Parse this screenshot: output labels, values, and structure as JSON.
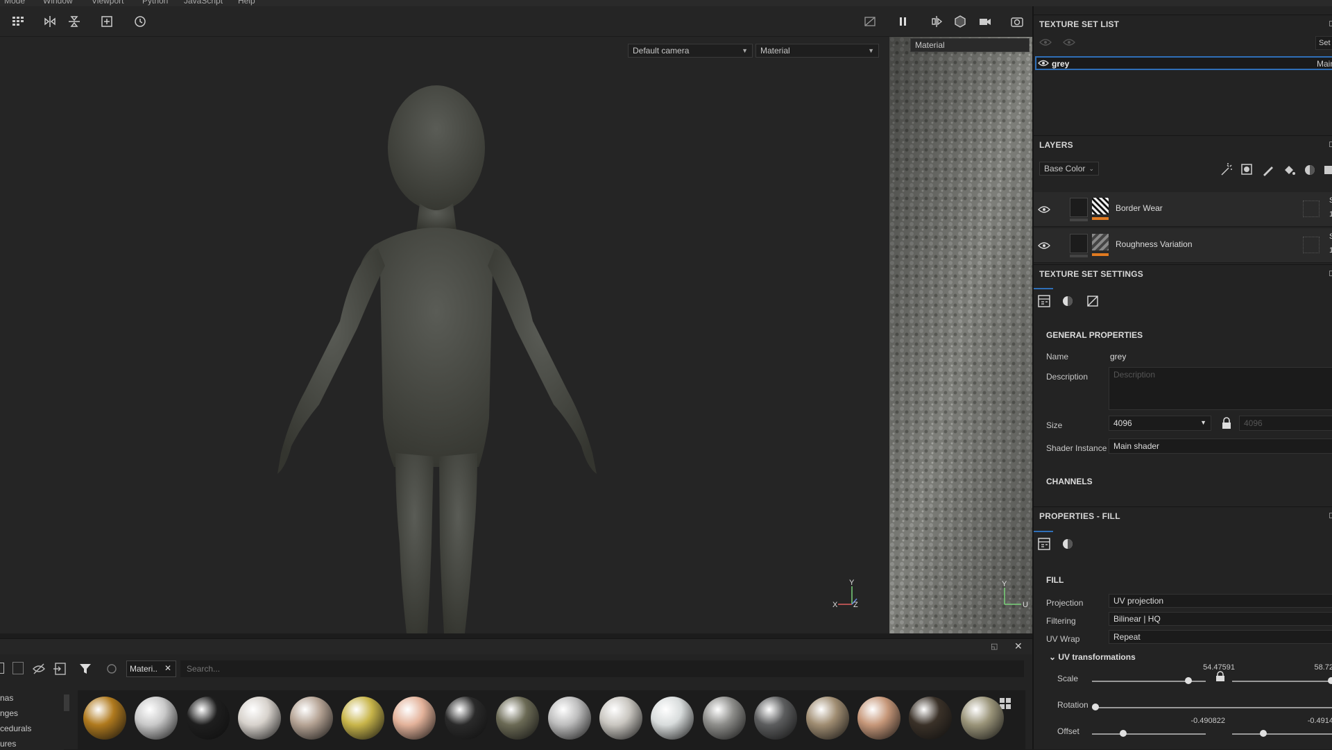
{
  "menu": [
    "Mode",
    "Window",
    "Viewport",
    "Python",
    "JavaScript",
    "Help"
  ],
  "viewport": {
    "camera_dropdown": "Default camera",
    "mode_dropdown": "Material",
    "uv_mode_dropdown": "Material",
    "axis_3d": {
      "y": "Y",
      "x": "X",
      "z": "Z"
    },
    "axis_uv": {
      "y": "Y",
      "u": "U"
    }
  },
  "texture_set_list": {
    "title": "TEXTURE SET LIST",
    "settings_btn": "Set",
    "item": {
      "name": "grey",
      "shader": "Main"
    }
  },
  "layers": {
    "title": "LAYERS",
    "channel_dropdown": "Base Color",
    "items": [
      {
        "name": "Border Wear",
        "blend": "S",
        "opacity": "1"
      },
      {
        "name": "Roughness Variation",
        "blend": "S",
        "opacity": "1"
      }
    ]
  },
  "texture_set_settings": {
    "title": "TEXTURE SET SETTINGS",
    "general_title": "GENERAL PROPERTIES",
    "name_label": "Name",
    "name_value": "grey",
    "description_label": "Description",
    "description_placeholder": "Description",
    "size_label": "Size",
    "size_value": "4096",
    "size_locked_value": "4096",
    "shader_label": "Shader Instance",
    "shader_value": "Main shader",
    "channels_title": "CHANNELS"
  },
  "properties_fill": {
    "title": "PROPERTIES - FILL",
    "fill_title": "FILL",
    "projection_label": "Projection",
    "projection_value": "UV projection",
    "filtering_label": "Filtering",
    "filtering_value": "Bilinear | HQ",
    "uvwrap_label": "UV Wrap",
    "uvwrap_value": "Repeat",
    "uv_transform_title": "UV transformations",
    "scale_label": "Scale",
    "scale_value": "54.47591",
    "scale_value_2": "58.72",
    "rotation_label": "Rotation",
    "offset_label": "Offset",
    "offset_value": "-0.490822",
    "offset_value_2": "-0.4914"
  },
  "shelf": {
    "categories": [
      "nas",
      "nges",
      "cedurals",
      "ures"
    ],
    "tab_label": "Materi..",
    "search_placeholder": "Search...",
    "sphere_colors": [
      "#b07a1e",
      "#c9c9c9",
      "#1e1e1e",
      "#d7d2cc",
      "#b5a394",
      "#c8b54a",
      "#e3b29a",
      "#2a2a2a",
      "#6b6a55",
      "#bdbdbd",
      "#c9c6c0",
      "#d8dcdc",
      "#8d8d8a",
      "#5c5d5e",
      "#a08d72",
      "#c69779",
      "#3a3128",
      "#9a9479"
    ]
  }
}
